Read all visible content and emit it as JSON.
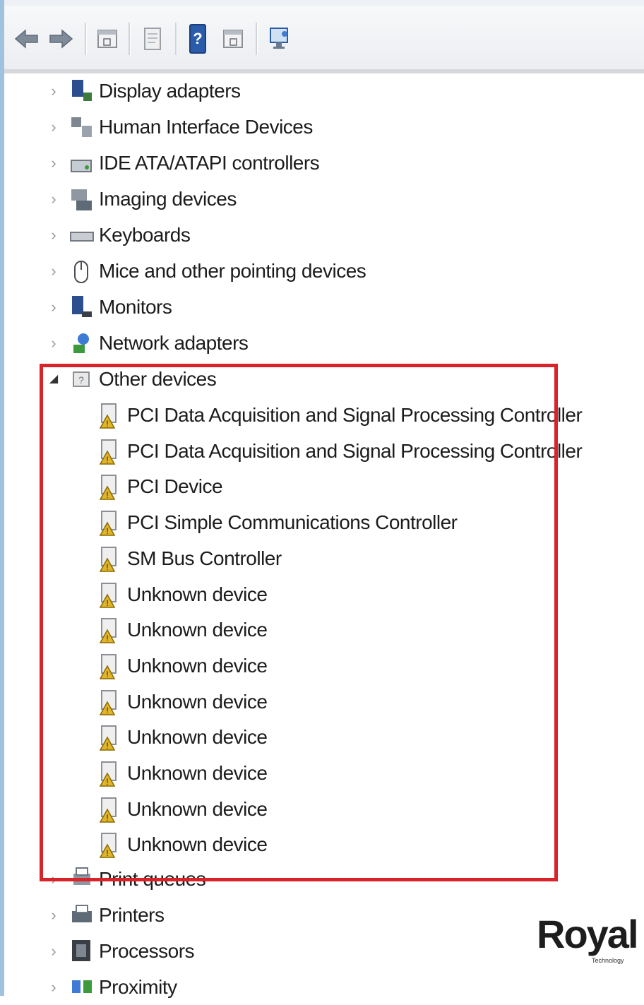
{
  "colors": {
    "highlight": "#d8232a",
    "warning_icon": "#e0b52a",
    "accent": "#2a5caa"
  },
  "toolbar": {
    "buttons": [
      {
        "name": "back-button",
        "icon": "back-arrow-icon"
      },
      {
        "name": "forward-button",
        "icon": "forward-arrow-icon"
      },
      {
        "name": "show-hide-console-tree-button",
        "icon": "console-tree-icon"
      },
      {
        "name": "properties-button",
        "icon": "properties-icon"
      },
      {
        "name": "help-button",
        "icon": "help-icon"
      },
      {
        "name": "action-pane-button",
        "icon": "action-pane-icon"
      },
      {
        "name": "scan-hardware-button",
        "icon": "monitor-scan-icon"
      }
    ]
  },
  "tree": {
    "categories": [
      {
        "label": "Display adapters",
        "icon": "display-adapter-icon",
        "state": "collapsed"
      },
      {
        "label": "Human Interface Devices",
        "icon": "hid-icon",
        "state": "collapsed"
      },
      {
        "label": "IDE ATA/ATAPI controllers",
        "icon": "ide-controller-icon",
        "state": "collapsed"
      },
      {
        "label": "Imaging devices",
        "icon": "imaging-icon",
        "state": "collapsed"
      },
      {
        "label": "Keyboards",
        "icon": "keyboard-icon",
        "state": "collapsed"
      },
      {
        "label": "Mice and other pointing devices",
        "icon": "mouse-icon",
        "state": "collapsed"
      },
      {
        "label": "Monitors",
        "icon": "monitor-icon",
        "state": "collapsed"
      },
      {
        "label": "Network adapters",
        "icon": "network-icon",
        "state": "collapsed"
      },
      {
        "label": "Other devices",
        "icon": "other-devices-icon",
        "state": "expanded"
      }
    ],
    "other_devices": [
      "PCI Data Acquisition and Signal Processing Controller",
      "PCI Data Acquisition and Signal Processing Controller",
      "PCI Device",
      "PCI Simple Communications Controller",
      "SM Bus Controller",
      "Unknown device",
      "Unknown device",
      "Unknown device",
      "Unknown device",
      "Unknown device",
      "Unknown device",
      "Unknown device",
      "Unknown device"
    ],
    "after": [
      {
        "label": "Print queues",
        "icon": "print-queue-icon",
        "state": "collapsed"
      },
      {
        "label": "Printers",
        "icon": "printer-icon",
        "state": "collapsed"
      },
      {
        "label": "Processors",
        "icon": "processor-icon",
        "state": "collapsed"
      },
      {
        "label": "Proximity",
        "icon": "proximity-icon",
        "state": "collapsed"
      }
    ]
  },
  "watermark": {
    "text": "Royal",
    "subtext": "Technology"
  }
}
